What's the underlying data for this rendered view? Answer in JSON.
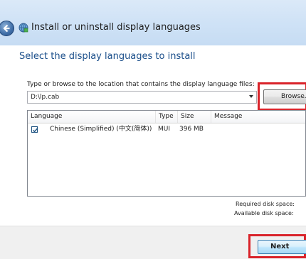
{
  "window": {
    "title": "Install or uninstall display languages"
  },
  "page": {
    "main_instruction": "Select the display languages to install",
    "field_label": "Type or browse to the location that contains the display language files:"
  },
  "path_input": {
    "value": "D:\\lp.cab"
  },
  "buttons": {
    "browse_label": "Browse...",
    "next_label": "Next"
  },
  "table": {
    "columns": [
      "Language",
      "Type",
      "Size",
      "Message"
    ],
    "rows": [
      {
        "checked": true,
        "language": "Chinese (Simplified) (中文(简体))",
        "type": "MUI",
        "size": "396 MB",
        "message": ""
      }
    ]
  },
  "disk": {
    "required_label": "Required disk space:",
    "available_label": "Available disk space:"
  },
  "colors": {
    "highlight": "#d9232a",
    "instruction_text": "#1a4e8a",
    "titlebar": "#cfe2f6"
  },
  "icons": {
    "back": "back-arrow-icon",
    "app": "language-globe-icon",
    "dropdown": "chevron-down-icon",
    "check": "checkmark-icon"
  }
}
